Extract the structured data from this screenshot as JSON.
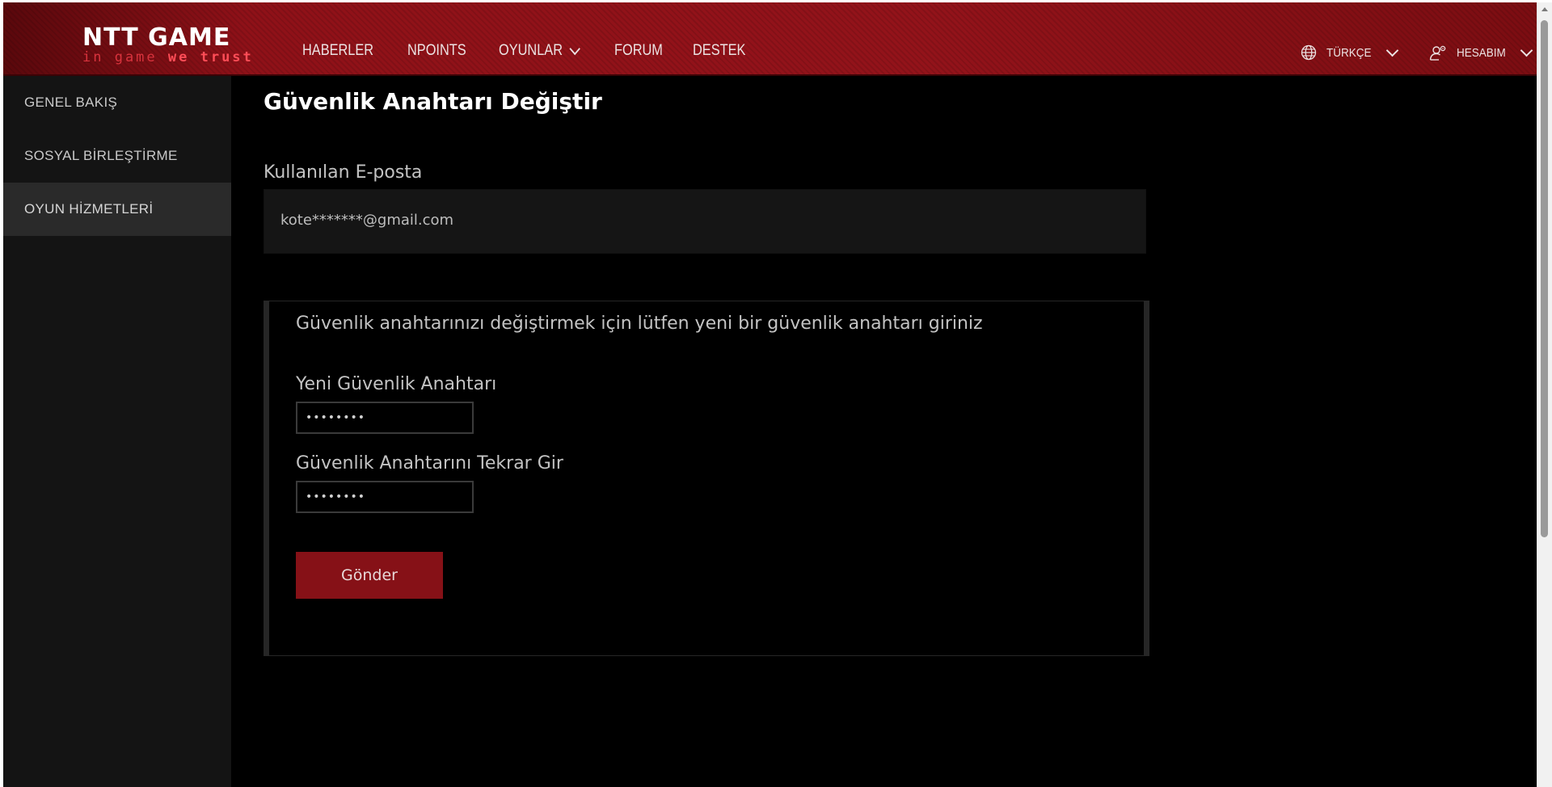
{
  "header": {
    "logo": {
      "main": "NTT GAME",
      "tagline_a": "in game ",
      "tagline_b": "we trust"
    },
    "nav": [
      {
        "label": "HABERLER"
      },
      {
        "label": "NPOINTS"
      },
      {
        "label": "OYUNLAR"
      },
      {
        "label": "FORUM"
      },
      {
        "label": "DESTEK"
      }
    ],
    "language": {
      "label": "TÜRKÇE",
      "icon": "globe-icon"
    },
    "account": {
      "label": "HESABIM",
      "icon": "user-settings-icon"
    }
  },
  "sidebar": {
    "items": [
      {
        "label": "GENEL BAKIŞ"
      },
      {
        "label": "SOSYAL BİRLEŞTİRME"
      },
      {
        "label": "OYUN HİZMETLERİ",
        "active": true
      }
    ]
  },
  "main": {
    "title": "Güvenlik Anahtarı Değiştir",
    "email_label": "Kullanılan E-posta",
    "email_value": "kote*******@gmail.com",
    "panel": {
      "info": "Güvenlik anahtarınızı değiştirmek için lütfen yeni bir güvenlik anahtarı giriniz",
      "new_key_label": "Yeni Güvenlik Anahtarı",
      "new_key_value": "••••••••",
      "repeat_key_label": "Güvenlik Anahtarını Tekrar Gir",
      "repeat_key_value": "••••••••",
      "submit_label": "Gönder"
    }
  },
  "colors": {
    "brand_red": "#8f1117",
    "button_red": "#861117",
    "background": "#000000",
    "sidebar": "#141414"
  }
}
